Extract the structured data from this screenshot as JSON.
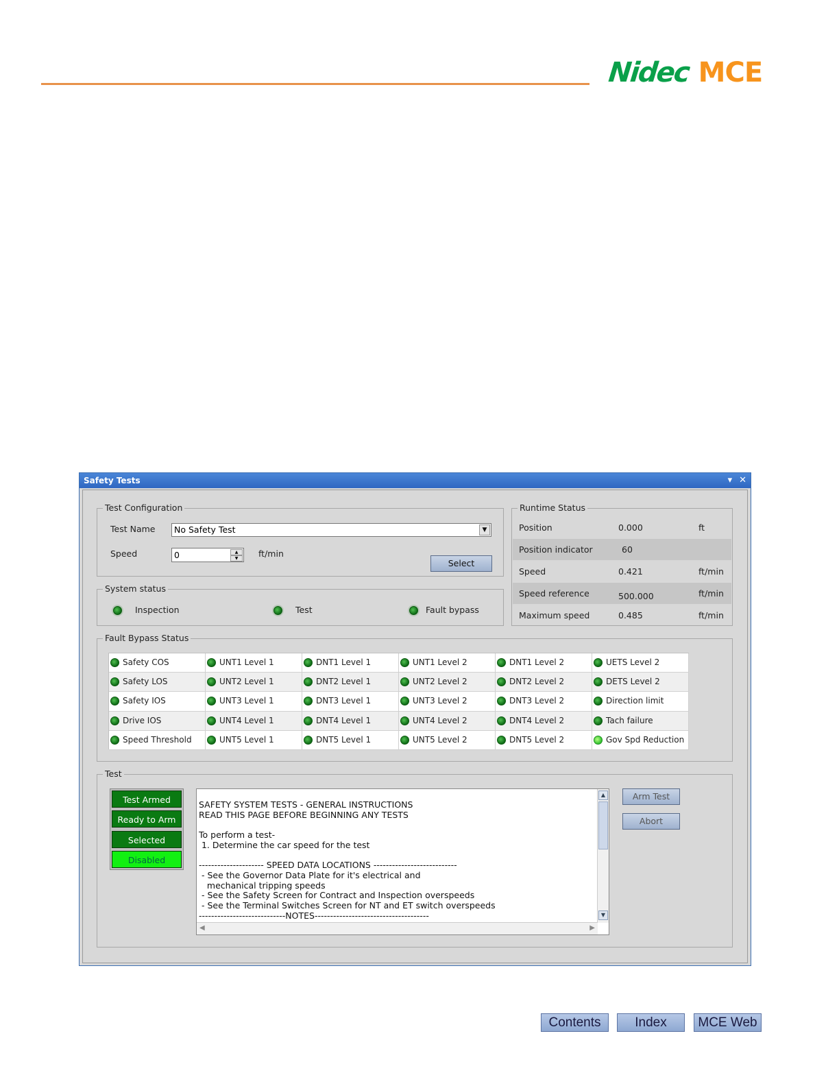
{
  "brand": {
    "name_left": "Nidec",
    "name_right": "MCE",
    "accent": "#e8924a",
    "green": "#0aa04a",
    "orange": "#f7941d"
  },
  "window": {
    "title": "Safety Tests"
  },
  "test_config": {
    "legend": "Test Configuration",
    "test_name_label": "Test Name",
    "test_name_value": "No Safety Test",
    "speed_label": "Speed",
    "speed_value": "0",
    "speed_unit": "ft/min",
    "select_label": "Select"
  },
  "runtime": {
    "legend": "Runtime Status",
    "rows": [
      {
        "label": "Position",
        "value": "0.000",
        "unit": "ft"
      },
      {
        "label": "Position indicator",
        "value": "60",
        "unit": ""
      },
      {
        "label": "Speed",
        "value": "0.421",
        "unit": "ft/min"
      },
      {
        "label": "Speed reference",
        "value": "500.000",
        "unit": "ft/min"
      },
      {
        "label": "Maximum speed",
        "value": "0.485",
        "unit": "ft/min"
      }
    ]
  },
  "system_status": {
    "legend": "System status",
    "items": [
      "Inspection",
      "Test",
      "Fault bypass"
    ]
  },
  "fault_bypass": {
    "legend": "Fault Bypass Status",
    "cells": [
      "Safety COS",
      "UNT1 Level 1",
      "DNT1 Level 1",
      "UNT1 Level 2",
      "DNT1 Level 2",
      "UETS Level 2",
      "Safety LOS",
      "UNT2 Level 1",
      "DNT2 Level 1",
      "UNT2 Level 2",
      "DNT2 Level 2",
      "DETS Level 2",
      "Safety IOS",
      "UNT3 Level 1",
      "DNT3 Level 1",
      "UNT3 Level 2",
      "DNT3 Level 2",
      "Direction limit",
      "Drive IOS",
      "UNT4 Level 1",
      "DNT4 Level 1",
      "UNT4 Level 2",
      "DNT4 Level 2",
      "Tach failure",
      "Speed Threshold",
      "UNT5 Level 1",
      "DNT5 Level 1",
      "UNT5 Level 2",
      "DNT5 Level 2",
      "Gov Spd Reduction"
    ]
  },
  "test": {
    "legend": "Test",
    "states": [
      "Test Armed",
      "Ready to Arm",
      "Selected",
      "Disabled"
    ],
    "arm_label": "Arm Test",
    "abort_label": "Abort",
    "instructions": "SAFETY SYSTEM TESTS - GENERAL INSTRUCTIONS\nREAD THIS PAGE BEFORE BEGINNING ANY TESTS\n\nTo perform a test-\n 1. Determine the car speed for the test\n\n--------------------- SPEED DATA LOCATIONS ---------------------------\n - See the Governor Data Plate for it's electrical and\n   mechanical tripping speeds\n - See the Safety Screen for Contract and Inspection overspeeds\n - See the Terminal Switches Screen for NT and ET switch overspeeds\n----------------------------NOTES-------------------------------------"
  },
  "footer": {
    "contents": "Contents",
    "index": "Index",
    "web": "MCE Web"
  }
}
